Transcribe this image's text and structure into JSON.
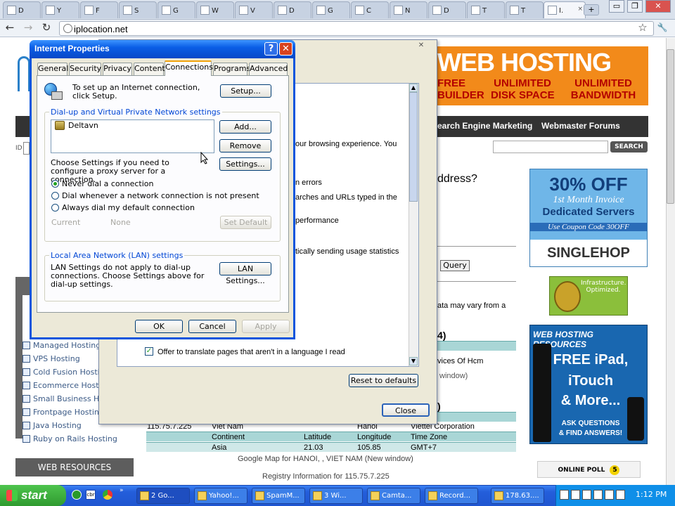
{
  "browser": {
    "tabs": [
      {
        "letter": "D"
      },
      {
        "letter": "Y"
      },
      {
        "letter": "F"
      },
      {
        "letter": "S"
      },
      {
        "letter": "G"
      },
      {
        "letter": "W"
      },
      {
        "letter": "V"
      },
      {
        "letter": "D"
      },
      {
        "letter": "G"
      },
      {
        "letter": "C"
      },
      {
        "letter": "N"
      },
      {
        "letter": "D"
      },
      {
        "letter": "T"
      },
      {
        "letter": "T"
      }
    ],
    "active_tab": {
      "letter": "I.",
      "close": "×"
    },
    "new_tab": "+",
    "url": "iplocation.net",
    "back": "←",
    "forward": "→",
    "reload": "↻",
    "star": "☆",
    "wrench": "🔧",
    "win_min": "▭",
    "win_max": "❐",
    "win_close": "✕"
  },
  "webpage": {
    "banner": {
      "headline": "WEB HOSTING",
      "col1": "FREE\nBUILDER",
      "col2": "UNLIMITED\nDISK SPACE",
      "col3": "UNLIMITED\nBANDWIDTH"
    },
    "nav": {
      "sem": "Search Engine Marketing",
      "forums": "Webmaster Forums"
    },
    "search_btn": "SEARCH",
    "left_mark": "ID",
    "left_links": [
      "Managed Hosting",
      "VPS Hosting",
      "Cold Fusion Hosting",
      "Ecommerce Hosting",
      "Small Business Hosting",
      "Frontpage Hosting",
      "Java Hosting",
      "Ruby on Rails Hosting"
    ],
    "web_resources": "WEB RESOURCES",
    "title_fragment": "ddress?",
    "query_btn": "Query",
    "frag_data": "ata may vary from a",
    "frag_paren": "4)",
    "frag_services": "vices Of Hcm",
    "frag_window": "window)",
    "frag_paren2": ")",
    "table": {
      "row1": [
        "115.75.7.225",
        "Viet Nam",
        "Hanoi",
        "Viettel Corporation"
      ],
      "row2": [
        "Continent",
        "Latitude",
        "Longitude",
        "Time Zone"
      ],
      "row3": [
        "Asia",
        "21.03",
        "105.85",
        "GMT+7"
      ]
    },
    "google_map": "Google Map for HANOI, , VIET NAM (New window)",
    "registry": "Registry Information for 115.75.7.225",
    "ad1": {
      "line1": "30% OFF",
      "line2": "1st Month Invoice",
      "line3": "Dedicated Servers",
      "line4": "Use Coupon Code 30OFF",
      "logo": "SINGLEHOP"
    },
    "ad2": {
      "text": "Infrastructure. Optimized."
    },
    "ad3": {
      "head": "WEB HOSTING RESOURCES",
      "l1": "FREE iPad,",
      "l2": "iTouch",
      "l3": "& More...",
      "l4": "ASK QUESTIONS",
      "l5": "& FIND ANSWERS!"
    },
    "poll": {
      "label": "ONLINE POLL",
      "count": "5"
    }
  },
  "options_dialog": {
    "close_x": "✕",
    "frag_browsing": "our browsing experience. You",
    "frag_errors": "n errors",
    "frag_searches": "arches and URLs typed in the",
    "frag_performance": "performance",
    "frag_usage": "tically sending usage statistics",
    "translate_check": "✓",
    "translate_label": "Offer to translate pages that aren't in a language I read",
    "reset_btn": "Reset to defaults",
    "close_btn": "Close"
  },
  "internet_properties": {
    "title": "Internet Properties",
    "help": "?",
    "close": "✕",
    "tabs": [
      "General",
      "Security",
      "Privacy",
      "Content",
      "Connections",
      "Programs",
      "Advanced"
    ],
    "setup_text": "To set up an Internet connection, click Setup.",
    "setup_btn": "Setup...",
    "dialup_group": "Dial-up and Virtual Private Network settings",
    "vpn_entries": [
      "Deltavn"
    ],
    "add_btn": "Add...",
    "remove_btn": "Remove",
    "settings_btn": "Settings...",
    "proxy_text": "Choose Settings if you need to configure a proxy server for a connection.",
    "radio_never": "Never dial a connection",
    "radio_whenever": "Dial whenever a network connection is not present",
    "radio_always": "Always dial my default connection",
    "current_label": "Current",
    "current_value": "None",
    "set_default_btn": "Set Default",
    "lan_group": "Local Area Network (LAN) settings",
    "lan_text": "LAN Settings do not apply to dial-up connections. Choose Settings above for dial-up settings.",
    "lan_btn": "LAN Settings...",
    "ok_btn": "OK",
    "cancel_btn": "Cancel",
    "apply_btn": "Apply"
  },
  "taskbar": {
    "start": "start",
    "tasks": [
      "2 Go...",
      "Yahoo!...",
      "SpamM...",
      "3 Wi...",
      "Camta...",
      "Record...",
      "178.63...."
    ],
    "clock": "1:12 PM"
  }
}
